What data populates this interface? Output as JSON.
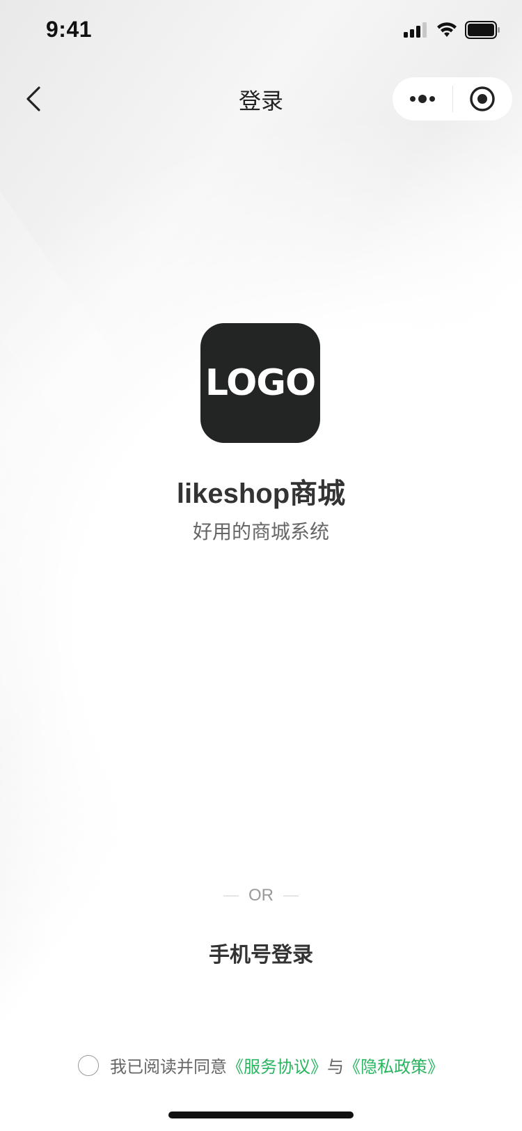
{
  "status_bar": {
    "time": "9:41"
  },
  "nav": {
    "title": "登录",
    "back_icon": "chevron-left-icon",
    "menu_icon": "more-dots-icon",
    "close_icon": "target-circle-icon"
  },
  "brand": {
    "logo_text": "LOGO",
    "name": "likeshop商城",
    "slogan": "好用的商城系统"
  },
  "login": {
    "or_text": "OR",
    "phone_login_label": "手机号登录"
  },
  "agreement": {
    "prefix": "我已阅读并同意",
    "service_link": "《服务协议》",
    "connector": "与",
    "privacy_link": "《隐私政策》"
  },
  "colors": {
    "accent_link": "#29b55f",
    "logo_bg": "#222524"
  }
}
